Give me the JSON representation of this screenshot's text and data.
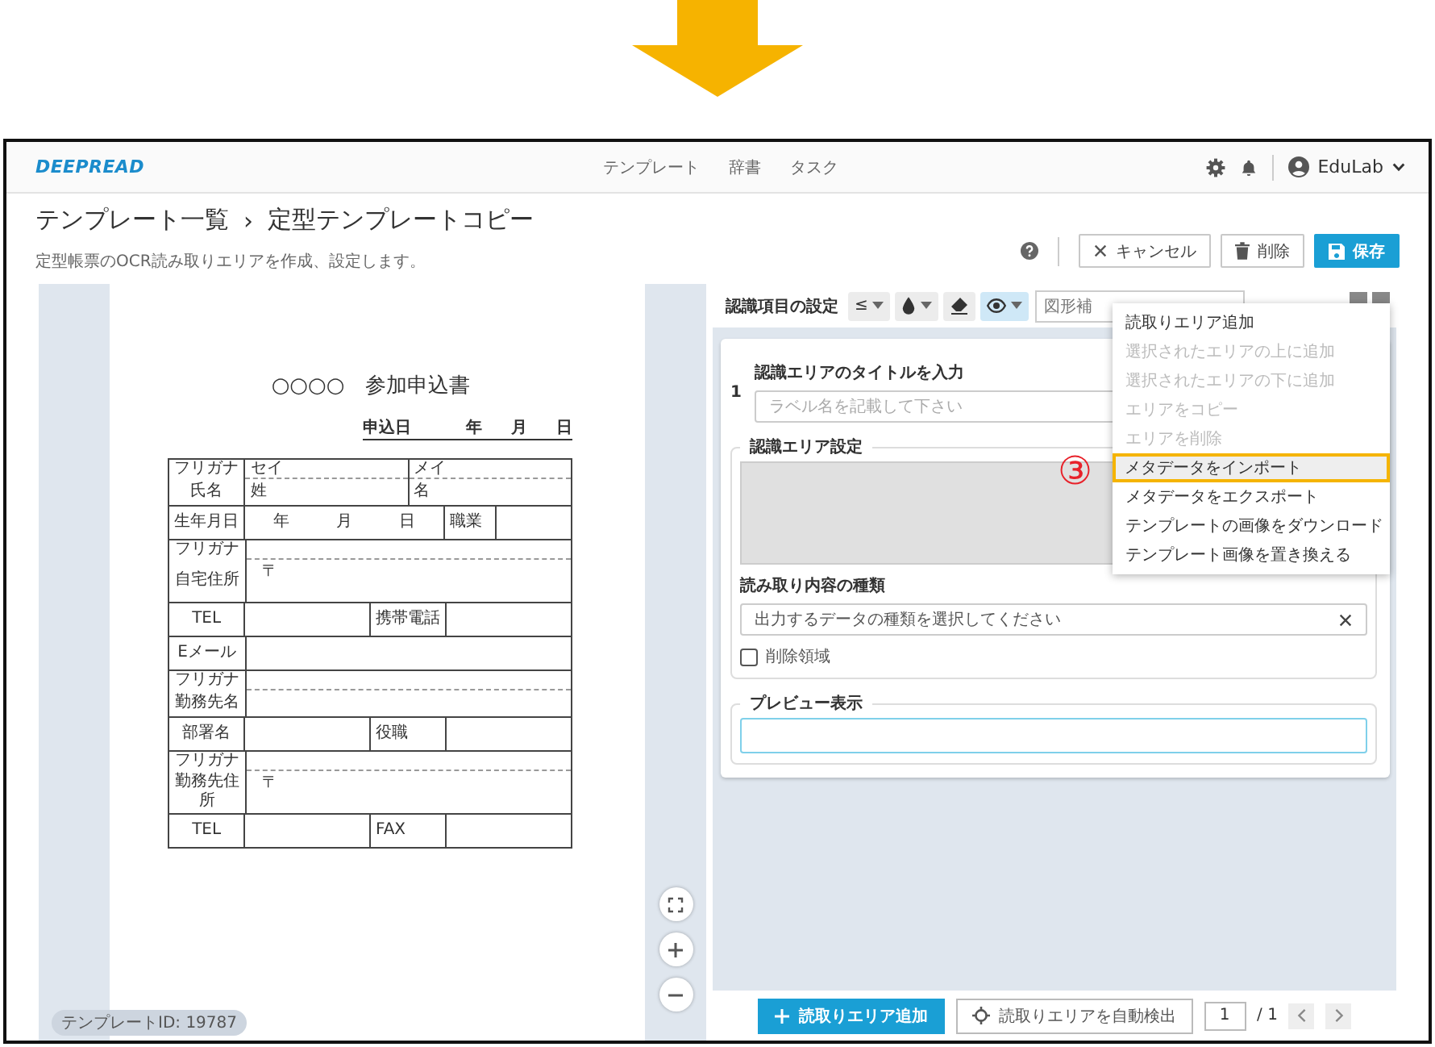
{
  "header": {
    "logo": "DEEPREAD",
    "nav": [
      {
        "label": "テンプレート"
      },
      {
        "label": "辞書"
      },
      {
        "label": "タスク"
      }
    ],
    "user": "EduLab"
  },
  "title_bar": {
    "breadcrumb": [
      "テンプレート一覧",
      "定型テンプレートコピー"
    ],
    "separator": "›",
    "subtitle": "定型帳票のOCR読み取りエリアを作成、設定します。",
    "buttons": [
      {
        "kind": "cancel",
        "label": "キャンセル"
      },
      {
        "kind": "delete",
        "label": "削除"
      },
      {
        "kind": "save",
        "label": "保存"
      }
    ]
  },
  "document": {
    "title": "○○○○　参加申込書",
    "date_label": "申込日",
    "date_parts": [
      "年",
      "月",
      "日"
    ],
    "rows": [
      {
        "furigana": true,
        "cells": [
          {
            "kind": "label",
            "ruby": "フリガナ",
            "text": "氏名"
          },
          {
            "kind": "name",
            "ruby": "セイ",
            "text": "姓"
          },
          {
            "kind": "name",
            "ruby": "メイ",
            "text": "名"
          }
        ]
      },
      {
        "furigana": false,
        "cells": [
          {
            "kind": "label",
            "text": "生年月日"
          },
          {
            "kind": "date",
            "parts": [
              "年",
              "月",
              "日"
            ]
          },
          {
            "kind": "tiny",
            "text": "職業"
          },
          {
            "kind": "small"
          }
        ]
      },
      {
        "furigana": true,
        "cells": [
          {
            "kind": "label",
            "ruby": "フリガナ",
            "text": "自宅住所"
          },
          {
            "kind": "address",
            "text": "〒"
          }
        ]
      },
      {
        "furigana": false,
        "cells": [
          {
            "kind": "label",
            "text": "TEL"
          },
          {
            "kind": "half"
          },
          {
            "kind": "small",
            "text": "携帯電話"
          },
          {
            "kind": "half"
          }
        ]
      },
      {
        "furigana": false,
        "cells": [
          {
            "kind": "label",
            "text": "Eメール"
          },
          {
            "kind": "wide"
          }
        ]
      },
      {
        "furigana": true,
        "cells": [
          {
            "kind": "label",
            "ruby": "フリガナ",
            "text": "勤務先名"
          },
          {
            "kind": "wide"
          }
        ]
      },
      {
        "furigana": false,
        "cells": [
          {
            "kind": "label",
            "text": "部署名"
          },
          {
            "kind": "half"
          },
          {
            "kind": "small",
            "text": "役職"
          },
          {
            "kind": "half"
          }
        ]
      },
      {
        "furigana": true,
        "cells": [
          {
            "kind": "label",
            "ruby": "フリガナ",
            "text": "勤務先住所"
          },
          {
            "kind": "address",
            "text": "〒"
          }
        ]
      },
      {
        "furigana": false,
        "cells": [
          {
            "kind": "label",
            "text": "TEL"
          },
          {
            "kind": "half"
          },
          {
            "kind": "small",
            "text": "FAX"
          },
          {
            "kind": "half"
          }
        ]
      }
    ],
    "template_id": "テンプレートID: 19787"
  },
  "settings": {
    "title": "認識項目の設定",
    "tools": [
      {
        "kind": "compare",
        "label": "≤",
        "caret": true,
        "selected": false
      },
      {
        "kind": "drop",
        "caret": true,
        "selected": false
      },
      {
        "kind": "eraser",
        "caret": false,
        "selected": false
      },
      {
        "kind": "eye",
        "caret": true,
        "selected": true
      }
    ],
    "shape_select": "図形補",
    "card": {
      "number": "1",
      "title_label": "認識エリアのタイトルを入力",
      "title_placeholder": "ラベル名を記載して下さい",
      "area_legend": "認識エリア設定",
      "type_label": "読み取り内容の種類",
      "type_placeholder": "出力するデータの種類を選択してください",
      "delete_area": {
        "label": "削除領域",
        "checked": false
      },
      "preview_legend": "プレビュー表示"
    },
    "menu": {
      "items": [
        {
          "label": "読取りエリア追加",
          "disabled": false,
          "selected": false
        },
        {
          "label": "選択されたエリアの上に追加",
          "disabled": true,
          "selected": false
        },
        {
          "label": "選択されたエリアの下に追加",
          "disabled": true,
          "selected": false
        },
        {
          "label": "エリアをコピー",
          "disabled": true,
          "selected": false
        },
        {
          "label": "エリアを削除",
          "disabled": true,
          "selected": false
        },
        {
          "label": "メタデータをインポート",
          "disabled": false,
          "selected": true
        },
        {
          "label": "メタデータをエクスポート",
          "disabled": false,
          "selected": false
        },
        {
          "label": "テンプレートの画像をダウンロード",
          "disabled": false,
          "selected": false
        },
        {
          "label": "テンプレート画像を置き換える",
          "disabled": false,
          "selected": false
        }
      ]
    },
    "callout": "③",
    "footer": {
      "add_button": "読取りエリア追加",
      "detect_button": "読取りエリアを自動検出",
      "page": "1",
      "page_total": "/ 1"
    }
  }
}
